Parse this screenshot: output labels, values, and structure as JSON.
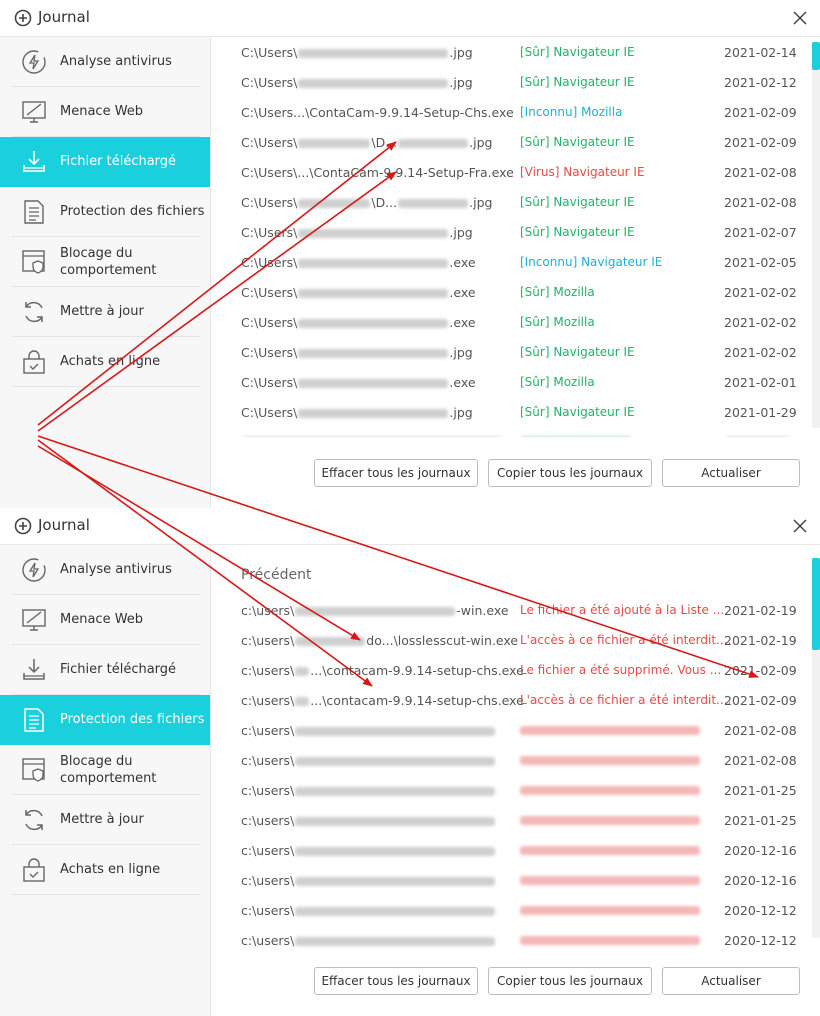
{
  "colors": {
    "accent": "#1ad0dc",
    "safe": "#1fb36a",
    "unknown": "#1ab0d8",
    "danger": "#e84a4a",
    "annotation": "#d81818"
  },
  "top": {
    "title": "Journal",
    "nav": [
      {
        "label": "Analyse antivirus",
        "icon": "lightning-circle-icon"
      },
      {
        "label": "Menace Web",
        "icon": "monitor-slash-icon"
      },
      {
        "label": "Fichier téléchargé",
        "icon": "download-tray-icon"
      },
      {
        "label": "Protection des fichiers",
        "icon": "document-lines-icon"
      },
      {
        "label": "Blocage du comportement",
        "icon": "browser-shield-icon"
      },
      {
        "label": "Mettre à jour",
        "icon": "refresh-icon"
      },
      {
        "label": "Achats en ligne",
        "icon": "shopping-bag-icon"
      }
    ],
    "rows": [
      {
        "path_start": "C:\\Users\\",
        "path_end": ".jpg",
        "status": "[Sûr] Navigateur IE",
        "status_type": "safe",
        "date": "2021-02-14"
      },
      {
        "path_start": "C:\\Users\\",
        "path_end": ".jpg",
        "status": "[Sûr] Navigateur IE",
        "status_type": "safe",
        "date": "2021-02-12"
      },
      {
        "path_start": "C:\\Users...\\ContaCam-9.9.14-Setup-Chs.exe",
        "path_end": "",
        "status": "[Inconnu] Mozilla",
        "status_type": "unknown",
        "date": "2021-02-09"
      },
      {
        "path_start": "C:\\Users\\",
        "path_end": "\\D...",
        "path_tail": ".jpg",
        "status": "[Sûr] Navigateur IE",
        "status_type": "safe",
        "date": "2021-02-09"
      },
      {
        "path_start": "C:\\Users\\...\\ContaCam-9.9.14-Setup-Fra.exe",
        "path_end": "",
        "status": "[Virus] Navigateur IE",
        "status_type": "danger",
        "date": "2021-02-08"
      },
      {
        "path_start": "C:\\Users\\",
        "path_end": "\\D...",
        "path_tail": ".jpg",
        "status": "[Sûr] Navigateur IE",
        "status_type": "safe",
        "date": "2021-02-08"
      },
      {
        "path_start": "C:\\Users\\",
        "path_end": ".jpg",
        "status": "[Sûr] Navigateur IE",
        "status_type": "safe",
        "date": "2021-02-07"
      },
      {
        "path_start": "C:\\Users\\",
        "path_end": ".exe",
        "status": "[Inconnu] Navigateur IE",
        "status_type": "unknown",
        "date": "2021-02-05"
      },
      {
        "path_start": "C:\\Users\\",
        "path_end": ".exe",
        "status": "[Sûr] Mozilla",
        "status_type": "safe",
        "date": "2021-02-02"
      },
      {
        "path_start": "C:\\Users\\",
        "path_end": ".exe",
        "status": "[Sûr] Mozilla",
        "status_type": "safe",
        "date": "2021-02-02"
      },
      {
        "path_start": "C:\\Users\\",
        "path_end": ".jpg",
        "status": "[Sûr] Navigateur IE",
        "status_type": "safe",
        "date": "2021-02-02"
      },
      {
        "path_start": "C:\\Users\\",
        "path_end": ".exe",
        "status": "[Sûr] Mozilla",
        "status_type": "safe",
        "date": "2021-02-01"
      },
      {
        "path_start": "C:\\Users\\",
        "path_end": ".jpg",
        "status": "[Sûr] Navigateur IE",
        "status_type": "safe",
        "date": "2021-01-29"
      }
    ],
    "buttons": {
      "clear": "Effacer tous les journaux",
      "copy": "Copier tous les journaux",
      "refresh": "Actualiser"
    }
  },
  "bottom": {
    "title": "Journal",
    "section_title": "Précédent",
    "nav": [
      {
        "label": "Analyse antivirus",
        "icon": "lightning-circle-icon"
      },
      {
        "label": "Menace Web",
        "icon": "monitor-slash-icon"
      },
      {
        "label": "Fichier téléchargé",
        "icon": "download-tray-icon"
      },
      {
        "label": "Protection des fichiers",
        "icon": "document-lines-icon"
      },
      {
        "label": "Blocage du comportement",
        "icon": "browser-shield-icon"
      },
      {
        "label": "Mettre à jour",
        "icon": "refresh-icon"
      },
      {
        "label": "Achats en ligne",
        "icon": "shopping-bag-icon"
      }
    ],
    "rows": [
      {
        "path_start": "c:\\users\\",
        "path_end": "-win.exe",
        "status": "Le fichier a été ajouté à la Liste ...",
        "date": "2021-02-19"
      },
      {
        "path_start": "c:\\users\\",
        "path_end": "do...\\losslesscut-win.exe",
        "status": "L'accès à ce fichier a été interdit....",
        "date": "2021-02-19"
      },
      {
        "path_start": "c:\\users\\",
        "path_end": "...\\contacam-9.9.14-setup-chs.exe",
        "status": "Le fichier a été supprimé. Vous ...",
        "date": "2021-02-09"
      },
      {
        "path_start": "c:\\users\\",
        "path_end": "...\\contacam-9.9.14-setup-chs.exe",
        "status": "L'accès à ce fichier a été interdit....",
        "date": "2021-02-09"
      },
      {
        "path_start": "c:\\users\\",
        "path_end": "",
        "status": "",
        "date": "2021-02-08"
      },
      {
        "path_start": "c:\\users\\",
        "path_end": "",
        "status": "",
        "date": "2021-02-08"
      },
      {
        "path_start": "c:\\users\\",
        "path_end": "",
        "status": "",
        "date": "2021-01-25"
      },
      {
        "path_start": "c:\\users\\",
        "path_end": "",
        "status": "",
        "date": "2021-01-25"
      },
      {
        "path_start": "c:\\users\\",
        "path_end": "",
        "status": "",
        "date": "2020-12-16"
      },
      {
        "path_start": "c:\\users\\",
        "path_end": "",
        "status": "",
        "date": "2020-12-16"
      },
      {
        "path_start": "c:\\users\\",
        "path_end": "",
        "status": "",
        "date": "2020-12-12"
      },
      {
        "path_start": "c:\\users\\",
        "path_end": "",
        "status": "",
        "date": "2020-12-12"
      }
    ],
    "buttons": {
      "clear": "Effacer tous les journaux",
      "copy": "Copier tous les journaux",
      "refresh": "Actualiser"
    }
  }
}
